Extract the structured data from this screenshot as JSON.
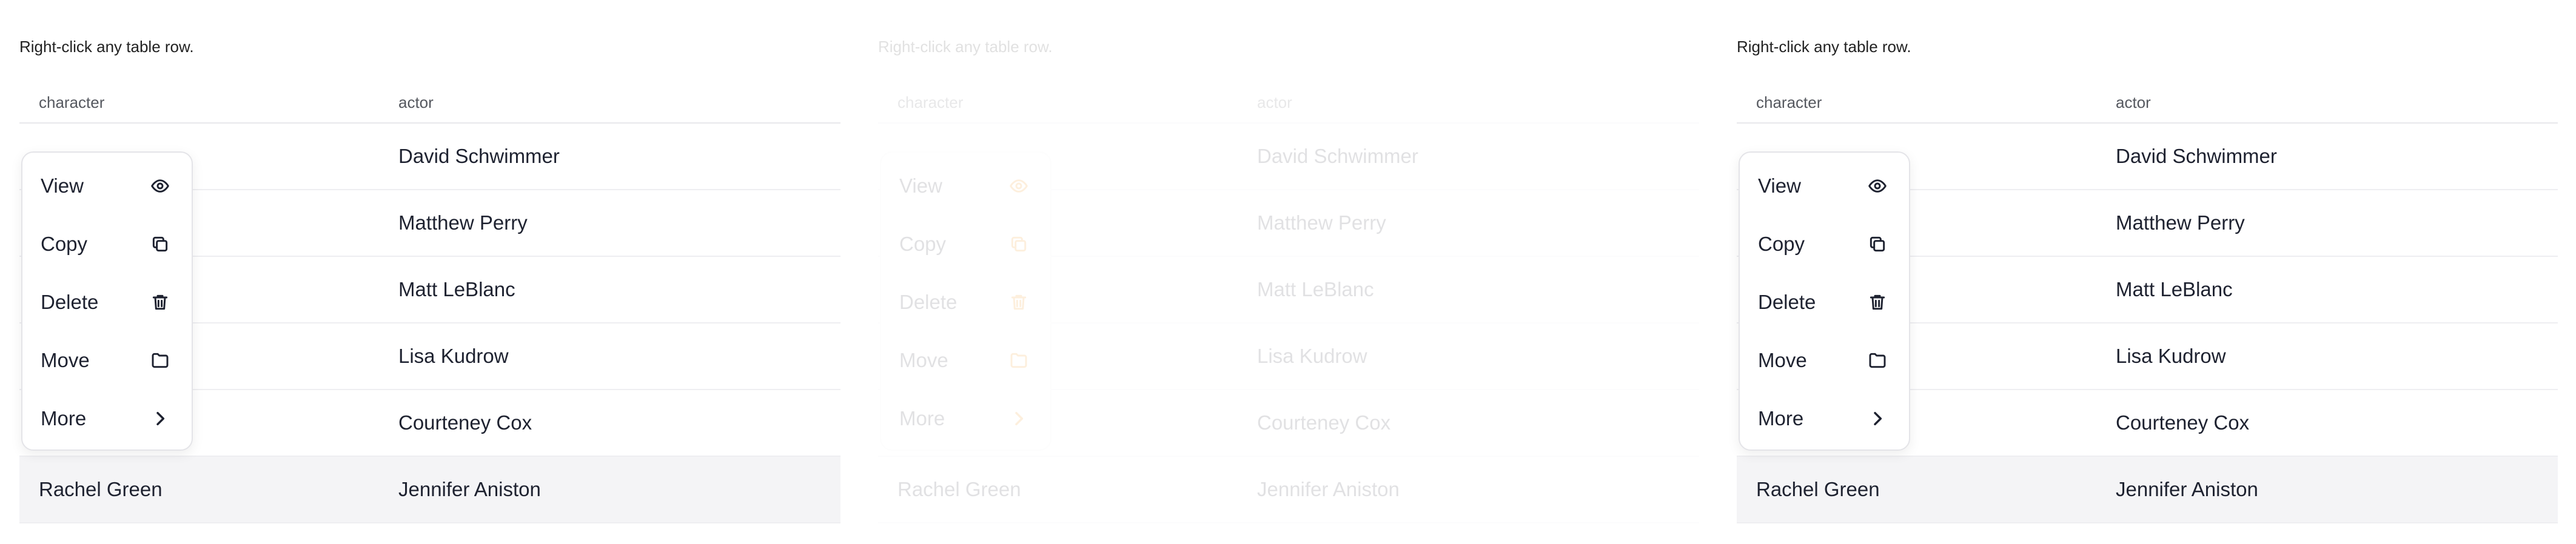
{
  "hint": "Right-click any table row.",
  "table": {
    "columns": [
      "character",
      "actor"
    ],
    "rows": [
      {
        "character": "",
        "actor": "David Schwimmer"
      },
      {
        "character": "",
        "actor": "Matthew Perry"
      },
      {
        "character": "",
        "actor": "Matt LeBlanc"
      },
      {
        "character": "",
        "actor": "Lisa Kudrow"
      },
      {
        "character": "",
        "actor": "Courteney Cox"
      },
      {
        "character": "Rachel Green",
        "actor": "Jennifer Aniston"
      }
    ]
  },
  "menu": {
    "items": [
      {
        "label": "View",
        "icon": "eye-icon"
      },
      {
        "label": "Copy",
        "icon": "copy-icon"
      },
      {
        "label": "Delete",
        "icon": "trash-icon"
      },
      {
        "label": "Move",
        "icon": "folder-icon"
      },
      {
        "label": "More",
        "icon": "chevron-right-icon"
      }
    ]
  },
  "colors": {
    "accent_faded_panel": "#f08c00",
    "row_highlight": "#f4f4f6"
  }
}
